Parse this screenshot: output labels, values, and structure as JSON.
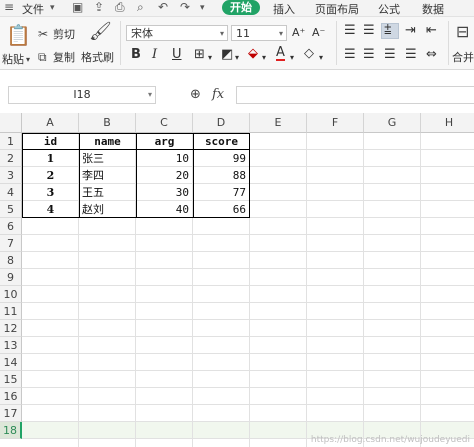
{
  "menu": {
    "file": "文件",
    "start": "开始",
    "insert": "插入",
    "page_layout": "页面布局",
    "formulas": "公式",
    "data": "数据"
  },
  "ribbon": {
    "paste": "粘贴",
    "cut": "剪切",
    "copy": "复制",
    "format_painter": "格式刷",
    "font_name": "宋体",
    "font_size": "11",
    "merge": "合并"
  },
  "formula_bar": {
    "name_box": "I18",
    "fx": "fx",
    "value": ""
  },
  "grid": {
    "columns": [
      "A",
      "B",
      "C",
      "D",
      "E",
      "F",
      "G",
      "H"
    ],
    "rows": [
      "1",
      "2",
      "3",
      "4",
      "5",
      "6",
      "7",
      "8",
      "9",
      "10",
      "11",
      "12",
      "13",
      "14",
      "15",
      "16",
      "17",
      "18"
    ],
    "active_row": "18",
    "table_header": [
      "id",
      "name",
      "arg",
      "score"
    ],
    "table_rows": [
      [
        "1",
        "张三",
        "10",
        "99"
      ],
      [
        "2",
        "李四",
        "20",
        "88"
      ],
      [
        "3",
        "王五",
        "30",
        "77"
      ],
      [
        "4",
        "赵刘",
        "40",
        "66"
      ]
    ]
  },
  "watermark": "https://blog.csdn.net/wujoudeyuedi"
}
